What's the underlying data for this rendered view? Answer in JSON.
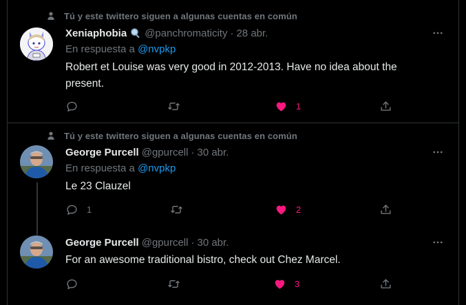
{
  "social_context": "Tú y este twittero siguen a algunas cuentas en común",
  "reply_prefix": "En respuesta a",
  "colors": {
    "link": "#1d9bf0",
    "like": "#f91880",
    "muted": "#71767b",
    "background": "#000000"
  },
  "tweets": [
    {
      "name": "Xeniaphobia",
      "badge_icon": "magnifier-icon",
      "handle": "@panchromaticity",
      "sep": "·",
      "date": "28 abr.",
      "reply_to": "@nvpkp",
      "text": "Robert et Louise was very good in 2012-2013. Have no idea about the present.",
      "reply_count": "",
      "like_count": "1"
    },
    {
      "name": "George Purcell",
      "handle": "@gpurcell",
      "sep": "·",
      "date": "30 abr.",
      "reply_to": "@nvpkp",
      "text": "Le 23 Clauzel",
      "reply_count": "1",
      "like_count": "2"
    },
    {
      "name": "George Purcell",
      "handle": "@gpurcell",
      "sep": "·",
      "date": "30 abr.",
      "text": "For an awesome traditional bistro, check out Chez Marcel.",
      "reply_count": "",
      "like_count": "3"
    }
  ]
}
